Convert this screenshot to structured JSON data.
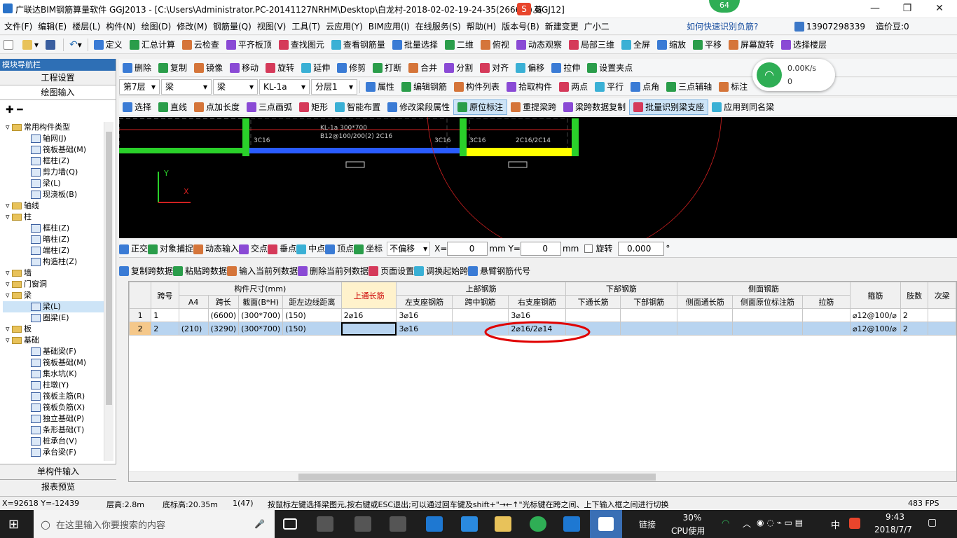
{
  "title": "广联达BIM钢筋算量软件 GGJ2013 - [C:\\Users\\Administrator.PC-20141127NRHM\\Desktop\\白龙村-2018-02-02-19-24-35(2666版).GGJ12]",
  "ime": {
    "label": "英",
    "badge": "64"
  },
  "menu": [
    "文件(F)",
    "编辑(E)",
    "楼层(L)",
    "构件(N)",
    "绘图(D)",
    "修改(M)",
    "钢筋量(Q)",
    "视图(V)",
    "工具(T)",
    "云应用(Y)",
    "BIM应用(I)",
    "在线服务(S)",
    "帮助(H)",
    "版本号(B)",
    "新建变更",
    "广小二"
  ],
  "menu_right": {
    "help_link": "如何快速识别负筋?",
    "phone": "13907298339",
    "price": "造价豆:0"
  },
  "toolbar1": [
    "定义",
    "汇总计算",
    "云检查",
    "平齐板顶",
    "查找图元",
    "查看钢筋量",
    "批量选择",
    "二维",
    "俯视",
    "动态观察",
    "局部三维",
    "全屏",
    "缩放",
    "平移",
    "屏幕旋转",
    "选择楼层"
  ],
  "toolbar2": [
    "删除",
    "复制",
    "镜像",
    "移动",
    "旋转",
    "延伸",
    "修剪",
    "打断",
    "合并",
    "分割",
    "对齐",
    "偏移",
    "拉伸",
    "设置夹点"
  ],
  "toolbar3": {
    "floor": "第7层",
    "type1": "梁",
    "type2": "梁",
    "name": "KL-1a",
    "layer": "分层1",
    "items": [
      "属性",
      "编辑钢筋",
      "构件列表",
      "拾取构件",
      "两点",
      "平行",
      "点角",
      "三点辅轴",
      "标注"
    ]
  },
  "toolbar4": [
    "选择",
    "直线",
    "点加长度",
    "三点画弧",
    "矩形",
    "智能布置",
    "修改梁段属性",
    "原位标注",
    "重提梁跨",
    "梁跨数据复制",
    "批量识别梁支座",
    "应用到同名梁"
  ],
  "net": {
    "speed": "0.00K/s",
    "count": "0"
  },
  "panel": {
    "header": "模块导航栏",
    "btn1": "工程设置",
    "btn2": "绘图输入",
    "btn3": "单构件输入",
    "btn4": "报表预览"
  },
  "tree": [
    {
      "t": "常用构件类型",
      "lvl": 0
    },
    {
      "t": "轴网(J)",
      "lvl": 1
    },
    {
      "t": "筏板基础(M)",
      "lvl": 1
    },
    {
      "t": "框柱(Z)",
      "lvl": 1
    },
    {
      "t": "剪力墙(Q)",
      "lvl": 1
    },
    {
      "t": "梁(L)",
      "lvl": 1
    },
    {
      "t": "现浇板(B)",
      "lvl": 1
    },
    {
      "t": "轴线",
      "lvl": 0
    },
    {
      "t": "柱",
      "lvl": 0
    },
    {
      "t": "框柱(Z)",
      "lvl": 1
    },
    {
      "t": "暗柱(Z)",
      "lvl": 1
    },
    {
      "t": "端柱(Z)",
      "lvl": 1
    },
    {
      "t": "构造柱(Z)",
      "lvl": 1
    },
    {
      "t": "墙",
      "lvl": 0
    },
    {
      "t": "门窗洞",
      "lvl": 0
    },
    {
      "t": "梁",
      "lvl": 0
    },
    {
      "t": "梁(L)",
      "lvl": 1
    },
    {
      "t": "圈梁(E)",
      "lvl": 1
    },
    {
      "t": "板",
      "lvl": 0
    },
    {
      "t": "基础",
      "lvl": 0
    },
    {
      "t": "基础梁(F)",
      "lvl": 1
    },
    {
      "t": "筏板基础(M)",
      "lvl": 1
    },
    {
      "t": "集水坑(K)",
      "lvl": 1
    },
    {
      "t": "柱墩(Y)",
      "lvl": 1
    },
    {
      "t": "筏板主筋(R)",
      "lvl": 1
    },
    {
      "t": "筏板负筋(X)",
      "lvl": 1
    },
    {
      "t": "独立基础(P)",
      "lvl": 1
    },
    {
      "t": "条形基础(T)",
      "lvl": 1
    },
    {
      "t": "桩承台(V)",
      "lvl": 1
    },
    {
      "t": "承台梁(F)",
      "lvl": 1
    }
  ],
  "canvas": {
    "label1": "KL-1a 300*700",
    "label2": "B12@100/200(2) 2C16",
    "r1": "3C16",
    "r2": "3C16",
    "r3": "3C16",
    "r4": "2C16/2C14",
    "axis_y": "Y",
    "axis_x": "X"
  },
  "snap": {
    "items": [
      "正交",
      "对象捕捉",
      "动态输入",
      "交点",
      "垂点",
      "中点",
      "顶点",
      "坐标"
    ],
    "offset": "不偏移",
    "x_label": "X=",
    "x_val": "0",
    "y_label": "mm Y=",
    "y_val": "0",
    "mm": "mm",
    "rotate": "旋转",
    "rotate_val": "0.000"
  },
  "gridtb": [
    "复制跨数据",
    "粘贴跨数据",
    "输入当前列数据",
    "删除当前列数据",
    "页面设置",
    "调换起始跨",
    "悬臂钢筋代号"
  ],
  "table": {
    "h_span": "跨号",
    "h_size": "构件尺寸(mm)",
    "h_top_long": "上通长筋",
    "h_top": "上部钢筋",
    "h_bot": "下部钢筋",
    "h_side": "侧面钢筋",
    "h_stir": "箍筋",
    "h_legs": "肢数",
    "h_next": "次梁",
    "sub": [
      "A4",
      "跨长",
      "截面(B*H)",
      "距左边线距离",
      "左支座钢筋",
      "跨中钢筋",
      "右支座钢筋",
      "下通长筋",
      "下部钢筋",
      "侧面通长筋",
      "侧面原位标注筋",
      "拉筋"
    ],
    "rows": [
      [
        "1",
        "1",
        "",
        "(6600)",
        "(300*700)",
        "(150)",
        "2⌀16",
        "3⌀16",
        "",
        "3⌀16",
        "",
        "",
        "",
        "",
        "",
        "⌀12@100/⌀",
        "2"
      ],
      [
        "2",
        "2",
        "(210)",
        "(3290)",
        "(300*700)",
        "(150)",
        "",
        "3⌀16",
        "",
        "2⌀16/2⌀14",
        "",
        "",
        "",
        "",
        "",
        "⌀12@100/⌀",
        "2"
      ]
    ]
  },
  "status": {
    "coords": "X=92618 Y=-12439",
    "floor_h": "层高:2.8m",
    "base_h": "底标高:20.35m",
    "count": "1(47)",
    "hint": "按鼠标左键选择梁图元,按右键或ESC退出;可以通过回车键及shift+\"→←↑\"光标键在跨之间、上下输入框之间进行切换",
    "fps": "483 FPS"
  },
  "taskbar": {
    "search": "在这里输入你要搜索的内容",
    "link": "链接",
    "cpu": "30%",
    "cpu_label": "CPU使用",
    "lang": "中",
    "time": "9:43",
    "date": "2018/7/7"
  },
  "colors": {
    "accent": "#2e6fb5",
    "selected_row": "#b8d4f0",
    "highlight_header": "#fff2cc",
    "annotation_red": "#e00000"
  }
}
